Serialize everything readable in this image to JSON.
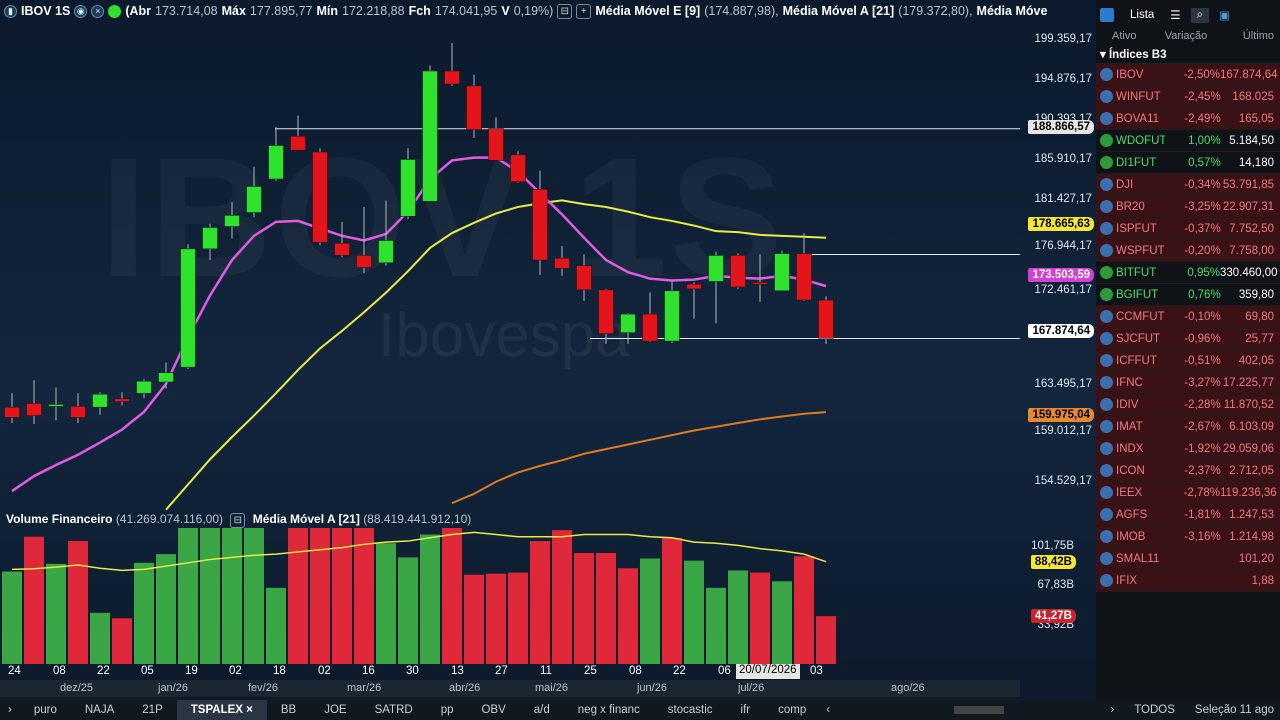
{
  "header": {
    "symbol": "IBOV 1S",
    "abr_label": "(Abr",
    "abr": "173.714,08",
    "max_label": "Máx",
    "max": "177.895,77",
    "min_label": "Mín",
    "min": "172.218,88",
    "fch_label": "Fch",
    "fch": "174.041,95",
    "var_label": "V",
    "var": "0,19%)",
    "ma1_label": "Média Móvel E [9]",
    "ma1": "(174.887,98),",
    "ma2_label": "Média Móvel A [21]",
    "ma2": "(179.372,80),",
    "ma3_label": "Média Móve"
  },
  "watermark": {
    "big": "IBOV 1S",
    "small": "Ibovespa"
  },
  "price_axis": {
    "ticks": [
      "199.359,17",
      "194.876,17",
      "190.393,17",
      "185.910,17",
      "181.427,17",
      "176.944,17",
      "172.461,17",
      "163.495,17",
      "159.012,17",
      "154.529,17"
    ],
    "badges": [
      {
        "text": "188.866,57",
        "bg": "#e6e6e6",
        "fg": "#000"
      },
      {
        "text": "178.665,63",
        "bg": "#f5e633",
        "fg": "#000"
      },
      {
        "text": "173.503,59",
        "bg": "#d43fd6",
        "fg": "#fff"
      },
      {
        "text": "167.874,64",
        "bg": "#ffffff",
        "fg": "#000"
      },
      {
        "text": "159.975,04",
        "bg": "#e8892e",
        "fg": "#000"
      }
    ],
    "vol_ticks": [
      "101,75B",
      "67,83B",
      "33,92B"
    ],
    "vol_badges": [
      {
        "text": "88,42B",
        "bg": "#f5e633",
        "fg": "#000"
      },
      {
        "text": "41,27B",
        "bg": "#c9232b",
        "fg": "#fff"
      }
    ]
  },
  "volume_label": {
    "name": "Volume Financeiro",
    "value": "(41.269.074.116,00)",
    "ma_name": "Média Móvel A [21]",
    "ma_value": "(88.419.441.912,10)"
  },
  "date_axis": {
    "labels": [
      "24",
      "08",
      "22",
      "05",
      "19",
      "02",
      "18",
      "02",
      "16",
      "30",
      "13",
      "27",
      "11",
      "25",
      "08",
      "22",
      "06",
      "03"
    ],
    "highlight": "20/07/2026"
  },
  "month_axis": [
    "dez/25",
    "jan/26",
    "fev/26",
    "mar/26",
    "abr/26",
    "mai/26",
    "jun/26",
    "jul/26",
    "ago/26"
  ],
  "tabs": [
    "puro",
    "NAJA",
    "21P",
    "TSPALEX",
    "BB",
    "JOE",
    "SATRD",
    "pp",
    "OBV",
    "a/d",
    "neg x financ",
    "stocastic",
    "ifr",
    "comp"
  ],
  "active_tab": "TSPALEX",
  "status": {
    "todos": "TODOS",
    "selection": "Seleção 11 ago"
  },
  "panel": {
    "title": "Lista",
    "columns": [
      "Ativo",
      "Variação",
      "Último"
    ],
    "group": "Índices B3",
    "rows": [
      {
        "name": "IBOV",
        "change": "-2,50%",
        "last": "167.874,64",
        "dir": "neg"
      },
      {
        "name": "WINFUT",
        "change": "-2,45%",
        "last": "168.025",
        "dir": "neg"
      },
      {
        "name": "BOVA11",
        "change": "-2,49%",
        "last": "165,05",
        "dir": "neg"
      },
      {
        "name": "WDOFUT",
        "change": "1,00%",
        "last": "5.184,50",
        "dir": "pos"
      },
      {
        "name": "DI1FUT",
        "change": "0,57%",
        "last": "14,180",
        "dir": "pos"
      },
      {
        "name": "DJI",
        "change": "-0,34%",
        "last": "53.791,85",
        "dir": "neg"
      },
      {
        "name": "BR20",
        "change": "-3,25%",
        "last": "22.907,31",
        "dir": "neg"
      },
      {
        "name": "ISPFUT",
        "change": "-0,37%",
        "last": "7.752,50",
        "dir": "neg"
      },
      {
        "name": "WSPFUT",
        "change": "-0,20%",
        "last": "7.758,00",
        "dir": "neg"
      },
      {
        "name": "BITFUT",
        "change": "0,95%",
        "last": "330.460,00",
        "dir": "pos"
      },
      {
        "name": "BGIFUT",
        "change": "0,76%",
        "last": "359,80",
        "dir": "pos"
      },
      {
        "name": "CCMFUT",
        "change": "-0,10%",
        "last": "69,80",
        "dir": "neg"
      },
      {
        "name": "SJCFUT",
        "change": "-0,96%",
        "last": "25,77",
        "dir": "neg"
      },
      {
        "name": "ICFFUT",
        "change": "-0,51%",
        "last": "402,05",
        "dir": "neg"
      },
      {
        "name": "IFNC",
        "change": "-3,27%",
        "last": "17.225,77",
        "dir": "neg"
      },
      {
        "name": "IDIV",
        "change": "-2,28%",
        "last": "11.870,52",
        "dir": "neg"
      },
      {
        "name": "IMAT",
        "change": "-2,67%",
        "last": "6.103,09",
        "dir": "neg"
      },
      {
        "name": "INDX",
        "change": "-1,92%",
        "last": "29.059,06",
        "dir": "neg"
      },
      {
        "name": "ICON",
        "change": "-2,37%",
        "last": "2.712,05",
        "dir": "neg"
      },
      {
        "name": "IEEX",
        "change": "-2,78%",
        "last": "119.236,36",
        "dir": "neg"
      },
      {
        "name": "AGFS",
        "change": "-1,81%",
        "last": "1.247,53",
        "dir": "neg"
      },
      {
        "name": "IMOB",
        "change": "-3,16%",
        "last": "1.214,98",
        "dir": "neg"
      },
      {
        "name": "SMAL11",
        "change": "",
        "last": "101,20",
        "dir": "neg"
      },
      {
        "name": "IFIX",
        "change": "",
        "last": "1,88",
        "dir": "neg"
      }
    ]
  },
  "chart_data": {
    "type": "candlestick",
    "price_ylim": [
      150000,
      201000
    ],
    "candles": [
      {
        "o": 160500,
        "h": 162000,
        "l": 158800,
        "c": 159400
      },
      {
        "o": 160900,
        "h": 163400,
        "l": 158700,
        "c": 159600
      },
      {
        "o": 160600,
        "h": 162600,
        "l": 159100,
        "c": 160800
      },
      {
        "o": 160600,
        "h": 162000,
        "l": 158800,
        "c": 159400
      },
      {
        "o": 160500,
        "h": 162100,
        "l": 159700,
        "c": 161900
      },
      {
        "o": 161400,
        "h": 162100,
        "l": 160700,
        "c": 161100
      },
      {
        "o": 162000,
        "h": 163500,
        "l": 161500,
        "c": 163300
      },
      {
        "o": 163200,
        "h": 165300,
        "l": 162500,
        "c": 164200
      },
      {
        "o": 164800,
        "h": 178000,
        "l": 164600,
        "c": 177500
      },
      {
        "o": 177500,
        "h": 180200,
        "l": 176300,
        "c": 179800
      },
      {
        "o": 179900,
        "h": 182500,
        "l": 178600,
        "c": 181100
      },
      {
        "o": 181400,
        "h": 186300,
        "l": 180900,
        "c": 184200
      },
      {
        "o": 185000,
        "h": 190600,
        "l": 184800,
        "c": 188600
      },
      {
        "o": 189600,
        "h": 191800,
        "l": 188100,
        "c": 188100
      },
      {
        "o": 187900,
        "h": 188300,
        "l": 177900,
        "c": 178200
      },
      {
        "o": 178100,
        "h": 180400,
        "l": 176600,
        "c": 176800
      },
      {
        "o": 176800,
        "h": 182000,
        "l": 174900,
        "c": 175500
      },
      {
        "o": 176000,
        "h": 182700,
        "l": 175700,
        "c": 178400
      },
      {
        "o": 181000,
        "h": 188300,
        "l": 180700,
        "c": 187100
      },
      {
        "o": 182600,
        "h": 197200,
        "l": 182600,
        "c": 196600
      },
      {
        "o": 196600,
        "h": 199600,
        "l": 195000,
        "c": 195200
      },
      {
        "o": 195000,
        "h": 196200,
        "l": 189400,
        "c": 190300
      },
      {
        "o": 190400,
        "h": 191600,
        "l": 187100,
        "c": 187000
      },
      {
        "o": 187600,
        "h": 188000,
        "l": 184600,
        "c": 184700
      },
      {
        "o": 183900,
        "h": 185900,
        "l": 174700,
        "c": 176300
      },
      {
        "o": 176500,
        "h": 177800,
        "l": 174600,
        "c": 175400
      },
      {
        "o": 175700,
        "h": 176900,
        "l": 171900,
        "c": 173100
      },
      {
        "o": 173100,
        "h": 173200,
        "l": 167300,
        "c": 168400
      },
      {
        "o": 168500,
        "h": 170600,
        "l": 167300,
        "c": 170500
      },
      {
        "o": 170500,
        "h": 172800,
        "l": 167500,
        "c": 167600
      },
      {
        "o": 167600,
        "h": 174000,
        "l": 167400,
        "c": 173000
      },
      {
        "o": 173700,
        "h": 173900,
        "l": 170000,
        "c": 173200
      },
      {
        "o": 174000,
        "h": 177200,
        "l": 169500,
        "c": 176800
      },
      {
        "o": 176800,
        "h": 177000,
        "l": 173200,
        "c": 173400
      },
      {
        "o": 173900,
        "h": 176900,
        "l": 171800,
        "c": 173700
      },
      {
        "o": 173000,
        "h": 177300,
        "l": 173300,
        "c": 177000
      },
      {
        "o": 177000,
        "h": 179200,
        "l": 171900,
        "c": 172000
      },
      {
        "o": 172000,
        "h": 172400,
        "l": 167300,
        "c": 167900
      }
    ],
    "ema9": [
      151500,
      153100,
      154300,
      155400,
      156700,
      158100,
      160000,
      163000,
      168000,
      172500,
      176300,
      178900,
      180400,
      180500,
      179700,
      178900,
      178400,
      179100,
      181500,
      185000,
      187000,
      187300,
      187300,
      185800,
      183500,
      181200,
      178700,
      176300,
      175000,
      174300,
      174100,
      174200,
      174600,
      174400,
      174300,
      174600,
      174200,
      173500
    ],
    "sma21": [
      null,
      null,
      null,
      null,
      null,
      null,
      null,
      149500,
      152200,
      154900,
      157300,
      159600,
      162000,
      164500,
      166800,
      168700,
      170700,
      172800,
      175100,
      177600,
      179200,
      180300,
      181300,
      182000,
      182400,
      182700,
      182300,
      182000,
      181500,
      180900,
      180500,
      180000,
      179400,
      179300,
      179000,
      178900,
      178800,
      178700
    ],
    "sma_slow": [
      null,
      null,
      null,
      null,
      null,
      null,
      null,
      null,
      null,
      null,
      null,
      null,
      null,
      null,
      null,
      null,
      null,
      null,
      null,
      null,
      150200,
      151200,
      152500,
      153500,
      154200,
      154800,
      155500,
      156000,
      156500,
      157000,
      157500,
      158000,
      158400,
      158800,
      159200,
      159500,
      159800,
      159975
    ],
    "hlines": [
      190393,
      176900,
      167874
    ],
    "volume_ylim": [
      0,
      125000
    ],
    "volume": [
      {
        "v": 85000,
        "dir": "g"
      },
      {
        "v": 117000,
        "dir": "r"
      },
      {
        "v": 92000,
        "dir": "g"
      },
      {
        "v": 113000,
        "dir": "r"
      },
      {
        "v": 47000,
        "dir": "g"
      },
      {
        "v": 42000,
        "dir": "r"
      },
      {
        "v": 93000,
        "dir": "g"
      },
      {
        "v": 101000,
        "dir": "g"
      },
      {
        "v": 130000,
        "dir": "g"
      },
      {
        "v": 130000,
        "dir": "g"
      },
      {
        "v": 130000,
        "dir": "g"
      },
      {
        "v": 130000,
        "dir": "g"
      },
      {
        "v": 70000,
        "dir": "g"
      },
      {
        "v": 130000,
        "dir": "r"
      },
      {
        "v": 130000,
        "dir": "r"
      },
      {
        "v": 130000,
        "dir": "r"
      },
      {
        "v": 130000,
        "dir": "r"
      },
      {
        "v": 111000,
        "dir": "g"
      },
      {
        "v": 98000,
        "dir": "g"
      },
      {
        "v": 119000,
        "dir": "g"
      },
      {
        "v": 130000,
        "dir": "r"
      },
      {
        "v": 82000,
        "dir": "r"
      },
      {
        "v": 83000,
        "dir": "r"
      },
      {
        "v": 84000,
        "dir": "r"
      },
      {
        "v": 113000,
        "dir": "r"
      },
      {
        "v": 123000,
        "dir": "r"
      },
      {
        "v": 102000,
        "dir": "r"
      },
      {
        "v": 102000,
        "dir": "r"
      },
      {
        "v": 88000,
        "dir": "r"
      },
      {
        "v": 97000,
        "dir": "g"
      },
      {
        "v": 116000,
        "dir": "r"
      },
      {
        "v": 95000,
        "dir": "g"
      },
      {
        "v": 70000,
        "dir": "g"
      },
      {
        "v": 86000,
        "dir": "g"
      },
      {
        "v": 84000,
        "dir": "r"
      },
      {
        "v": 76000,
        "dir": "g"
      },
      {
        "v": 99000,
        "dir": "r"
      },
      {
        "v": 44000,
        "dir": "r"
      }
    ],
    "volume_ma": [
      87000,
      87500,
      89000,
      91000,
      88000,
      86000,
      87000,
      90000,
      93000,
      96000,
      98000,
      100000,
      101000,
      103000,
      105000,
      107000,
      110000,
      112000,
      113000,
      116000,
      119000,
      121000,
      119000,
      117000,
      117000,
      117000,
      119000,
      119000,
      119000,
      117000,
      116000,
      112000,
      111000,
      109000,
      106000,
      104000,
      101000,
      94000
    ]
  },
  "colors": {
    "bull": "#2ee22e",
    "bear": "#e3141a",
    "ema9": "#e05ce3",
    "sma21": "#e8ea45",
    "sma_slow": "#e07a1f",
    "vol_green": "#3aa645",
    "vol_red": "#e0283b"
  }
}
